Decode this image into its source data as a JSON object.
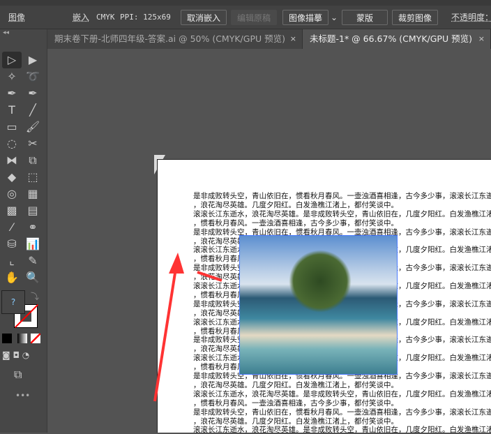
{
  "control_bar": {
    "panel": "图像",
    "embed": "嵌入",
    "color_mode": "CMYK",
    "ppi": "PPI: 125x69",
    "unembed": "取消嵌入",
    "edit_original": "编辑原稿",
    "image_trace": "图像描摹",
    "mask": "蒙版",
    "crop": "裁剪图像",
    "opacity": "不透明度："
  },
  "tabs": [
    {
      "label": "期末卷下册-北师四年级-答案.ai @ 50% (CMYK/GPU 预览)",
      "close": "×"
    },
    {
      "label": "未标题-1* @ 66.67% (CMYK/GPU 预览)",
      "close": "×"
    }
  ],
  "fill_stroke": {
    "unknown": "?"
  },
  "document": {
    "lines_a": [
      "是非成败转头空，青山依旧在，惯看秋月春风。一壶浊酒喜相逢，古今多少事，滚滚长江东逝",
      "，浪花淘尽英雄。几度夕阳红。白发渔樵江渚上，都付笑谈中。"
    ],
    "lines_b": [
      "滚滚长江东逝水，浪花淘尽英雄。是非成败转头空，青山依旧在，几度夕阳红。白发渔樵江渚",
      "，惯看秋月春风。一壶浊酒喜相逢，古今多少事，都付笑谈中。"
    ]
  },
  "accent": "#ff3333"
}
